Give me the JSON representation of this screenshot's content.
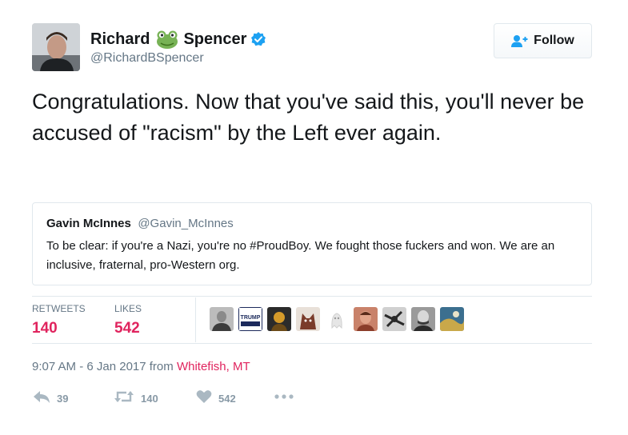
{
  "author": {
    "name_first": "Richard",
    "name_last": "Spencer",
    "handle": "@RichardBSpencer"
  },
  "follow_button": {
    "label": "Follow"
  },
  "tweet": {
    "text": "Congratulations. Now that you've said this, you'll never be accused of \"racism\" by the Left ever again."
  },
  "quoted_tweet": {
    "name": "Gavin McInnes",
    "handle": "@Gavin_McInnes",
    "text": "To be clear: if you're a Nazi, you're no #ProudBoy. We fought those fuckers and won. We are an inclusive, fraternal, pro-Western org."
  },
  "stats": {
    "retweets_label": "RETWEETS",
    "retweets_value": "140",
    "likes_label": "LIKES",
    "likes_value": "542"
  },
  "liker_avatar_colors": [
    "#5a5a5a",
    "#1c2a5c",
    "#2b2b2b",
    "#7a3b2a",
    "#e9e9e9",
    "#b07055",
    "#4a4a4a",
    "#555555",
    "#3c6f8f"
  ],
  "trump_avatar_text": "TRUMP",
  "timestamp": {
    "time": "9:07 AM - 6 Jan 2017 from",
    "location": "Whitefish, MT"
  },
  "actions": {
    "reply_count": "39",
    "retweet_count": "140",
    "like_count": "542"
  },
  "colors": {
    "accent_pink": "#e0245e",
    "muted_gray": "#657786",
    "verified_blue": "#1da1f2",
    "frog_green": "#77b255"
  }
}
